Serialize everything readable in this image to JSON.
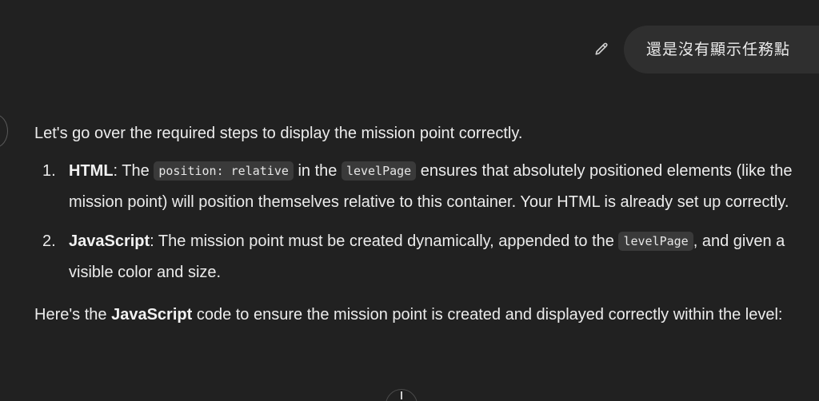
{
  "user_message": {
    "text": "還是沒有顯示任務點",
    "edit_icon": "pencil-icon"
  },
  "assistant": {
    "intro": "Let's go over the required steps to display the mission point correctly.",
    "steps": [
      {
        "number": "1.",
        "title": "HTML",
        "t1": ": The ",
        "code1": "position: relative",
        "t2": " in the ",
        "code2": "levelPage",
        "t3": " ensures that absolutely positioned elements (like the mission point) will position themselves relative to this container. Your HTML is already set up correctly."
      },
      {
        "number": "2.",
        "title": "JavaScript",
        "t1": ": The mission point must be created dynamically, appended to the ",
        "code1": "levelPage",
        "t2": ", and given a visible color and size."
      }
    ],
    "outro": {
      "t1": "Here's the ",
      "bold": "JavaScript",
      "t2": " code to ensure the mission point is created and displayed correctly within the level:"
    }
  },
  "icons": {
    "scroll": "arrow-down-icon"
  }
}
